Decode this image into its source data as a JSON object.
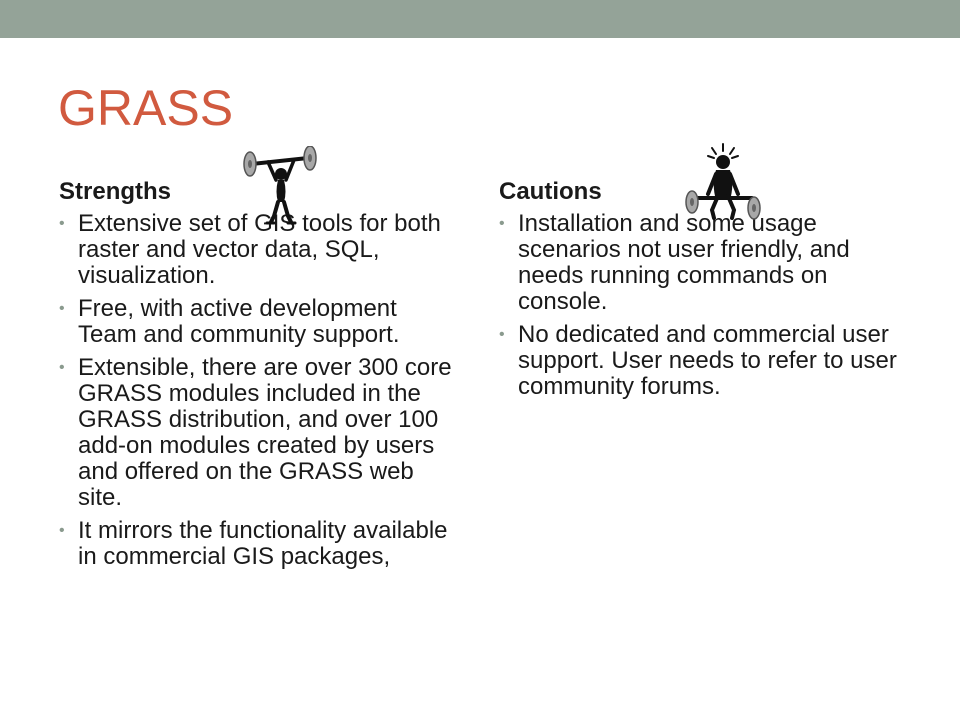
{
  "slide": {
    "title": "GRASS"
  },
  "strengths": {
    "heading": "Strengths",
    "items": [
      "Extensive set of GIS tools for both raster and vector data, SQL, visualization.",
      "Free, with active development Team and community support.",
      "Extensible, there are over 300 core GRASS modules included in the GRASS distribution, and over 100 add-on modules created by users and offered on the GRASS web site.",
      "It mirrors the functionality available in commercial GIS packages,"
    ]
  },
  "cautions": {
    "heading": "Cautions",
    "items": [
      "Installation and some usage scenarios not user friendly, and needs running commands on console.",
      "No dedicated and commercial user support. User needs to refer to user community forums."
    ]
  },
  "bullet_glyph": "•",
  "colors": {
    "top_bar": "#94a398",
    "title": "#d15a3f",
    "bullet": "#8a9a8e",
    "text": "#1a1a1a"
  },
  "icons": [
    "weightlifter-strong-icon",
    "weightlifter-straining-icon"
  ]
}
